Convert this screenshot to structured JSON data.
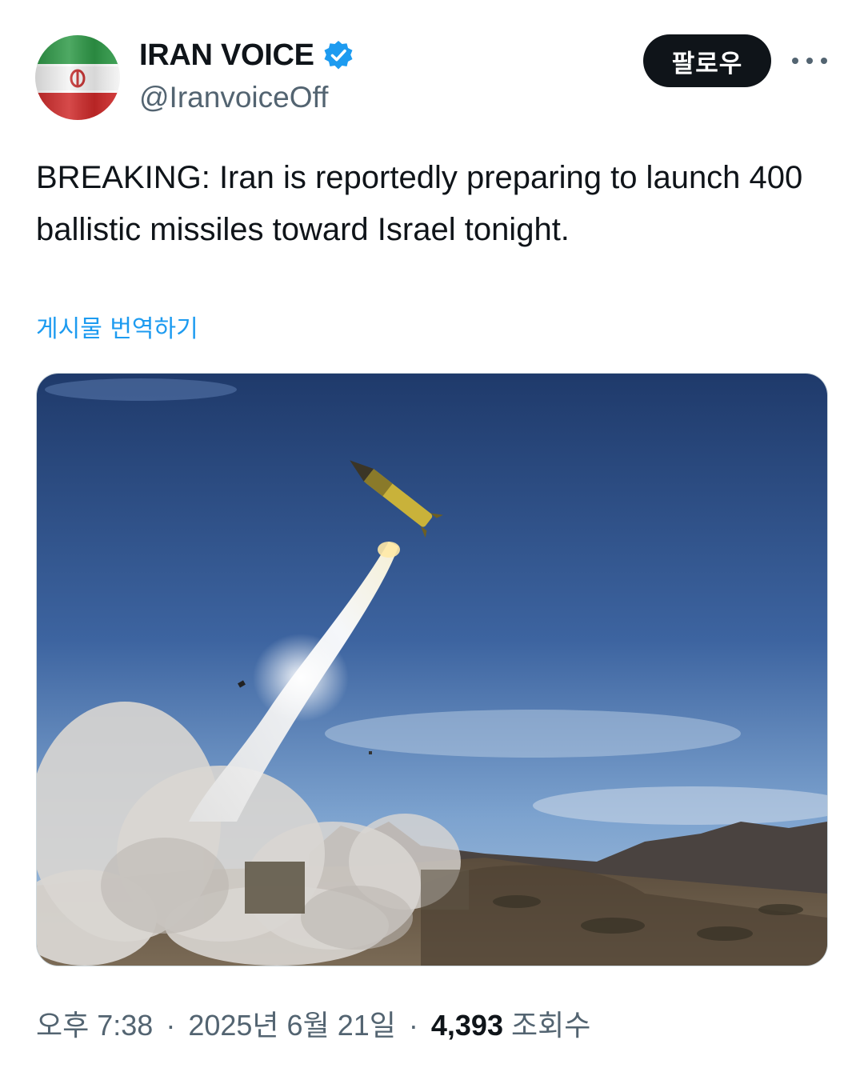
{
  "author": {
    "display_name": "IRAN VOICE",
    "handle": "@IranvoiceOff",
    "verified": true,
    "avatar": "iran-flag"
  },
  "actions": {
    "follow_label": "팔로우",
    "more_icon": "ellipsis-icon"
  },
  "post": {
    "text": "BREAKING: Iran is reportedly preparing to launch 400 ballistic missiles toward Israel tonight.",
    "translate_label": "게시물 번역하기",
    "media": "photo of a ballistic missile launching from a launcher, smoke trail over desert hills"
  },
  "meta": {
    "time": "오후 7:38",
    "date": "2025년 6월 21일",
    "separator": "·",
    "views_count": "4,393",
    "views_label": "조회수"
  },
  "colors": {
    "text_primary": "#0f1419",
    "text_secondary": "#536471",
    "link": "#1d9bf0",
    "verified": "#1d9bf0",
    "follow_bg": "#0f1419"
  }
}
